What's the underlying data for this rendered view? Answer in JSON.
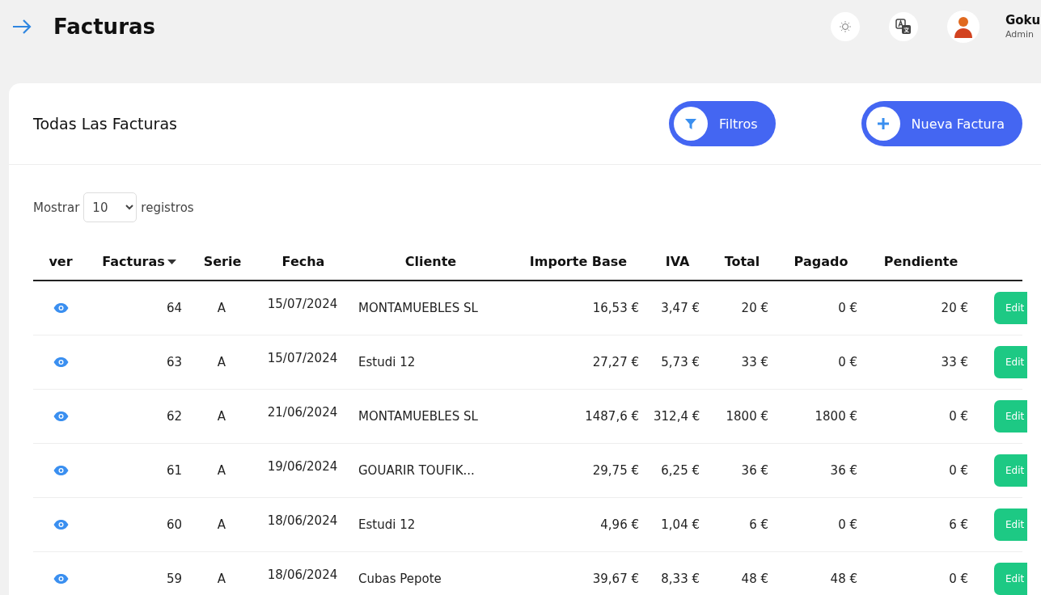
{
  "header": {
    "title": "Facturas",
    "user": {
      "name": "Goku",
      "role": "Admin"
    }
  },
  "card": {
    "title": "Todas Las Facturas",
    "filter_button": "Filtros",
    "new_button": "Nueva Factura"
  },
  "page_size": {
    "label_before": "Mostrar",
    "value": "10",
    "label_after": "registros"
  },
  "table": {
    "columns": [
      {
        "label": "ver",
        "sorted": false
      },
      {
        "label": "Facturas",
        "sorted": true
      },
      {
        "label": "Serie",
        "sorted": false
      },
      {
        "label": "Fecha",
        "sorted": false
      },
      {
        "label": "Cliente",
        "sorted": false
      },
      {
        "label": "Importe Base",
        "sorted": false
      },
      {
        "label": "IVA",
        "sorted": false
      },
      {
        "label": "Total",
        "sorted": false
      },
      {
        "label": "Pagado",
        "sorted": false
      },
      {
        "label": "Pendiente",
        "sorted": false
      }
    ],
    "rows": [
      {
        "number": "64",
        "serie": "A",
        "fecha": "15/07/2024",
        "cliente": "MONTAMUEBLES SL",
        "importe_base": "16,53 €",
        "iva": "3,47 €",
        "total": "20 €",
        "pagado": "0 €",
        "pendiente": "20 €",
        "action": "Edit"
      },
      {
        "number": "63",
        "serie": "A",
        "fecha": "15/07/2024",
        "cliente": "Estudi 12",
        "importe_base": "27,27 €",
        "iva": "5,73 €",
        "total": "33 €",
        "pagado": "0 €",
        "pendiente": "33 €",
        "action": "Edit"
      },
      {
        "number": "62",
        "serie": "A",
        "fecha": "21/06/2024",
        "cliente": "MONTAMUEBLES SL",
        "importe_base": "1487,6 €",
        "iva": "312,4 €",
        "total": "1800 €",
        "pagado": "1800 €",
        "pendiente": "0 €",
        "action": "Edit"
      },
      {
        "number": "61",
        "serie": "A",
        "fecha": "19/06/2024",
        "cliente": "GOUARIR TOUFIK...",
        "importe_base": "29,75 €",
        "iva": "6,25 €",
        "total": "36 €",
        "pagado": "36 €",
        "pendiente": "0 €",
        "action": "Edit"
      },
      {
        "number": "60",
        "serie": "A",
        "fecha": "18/06/2024",
        "cliente": "Estudi 12",
        "importe_base": "4,96 €",
        "iva": "1,04 €",
        "total": "6 €",
        "pagado": "0 €",
        "pendiente": "6 €",
        "action": "Edit"
      },
      {
        "number": "59",
        "serie": "A",
        "fecha": "18/06/2024",
        "cliente": "Cubas Pepote",
        "importe_base": "39,67 €",
        "iva": "8,33 €",
        "total": "48 €",
        "pagado": "48 €",
        "pendiente": "0 €",
        "action": "Edit"
      }
    ]
  }
}
